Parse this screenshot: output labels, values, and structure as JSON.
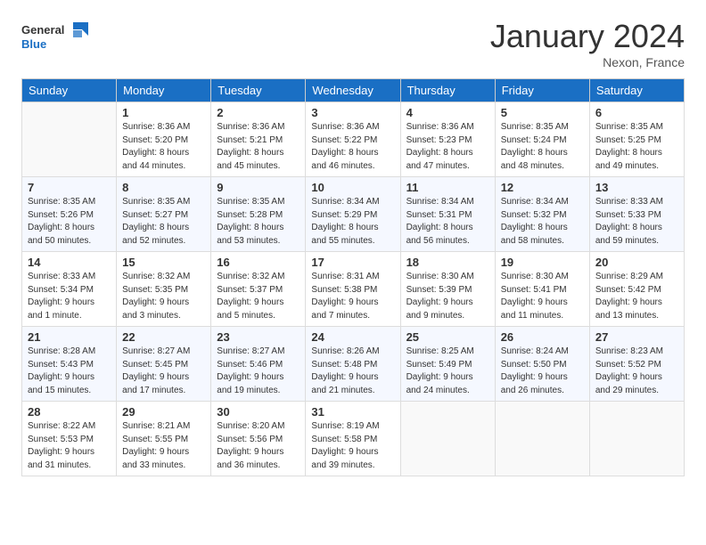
{
  "header": {
    "logo_general": "General",
    "logo_blue": "Blue",
    "title": "January 2024",
    "location": "Nexon, France"
  },
  "days_of_week": [
    "Sunday",
    "Monday",
    "Tuesday",
    "Wednesday",
    "Thursday",
    "Friday",
    "Saturday"
  ],
  "weeks": [
    [
      {
        "day": "",
        "sunrise": "",
        "sunset": "",
        "daylight": ""
      },
      {
        "day": "1",
        "sunrise": "Sunrise: 8:36 AM",
        "sunset": "Sunset: 5:20 PM",
        "daylight": "Daylight: 8 hours and 44 minutes."
      },
      {
        "day": "2",
        "sunrise": "Sunrise: 8:36 AM",
        "sunset": "Sunset: 5:21 PM",
        "daylight": "Daylight: 8 hours and 45 minutes."
      },
      {
        "day": "3",
        "sunrise": "Sunrise: 8:36 AM",
        "sunset": "Sunset: 5:22 PM",
        "daylight": "Daylight: 8 hours and 46 minutes."
      },
      {
        "day": "4",
        "sunrise": "Sunrise: 8:36 AM",
        "sunset": "Sunset: 5:23 PM",
        "daylight": "Daylight: 8 hours and 47 minutes."
      },
      {
        "day": "5",
        "sunrise": "Sunrise: 8:35 AM",
        "sunset": "Sunset: 5:24 PM",
        "daylight": "Daylight: 8 hours and 48 minutes."
      },
      {
        "day": "6",
        "sunrise": "Sunrise: 8:35 AM",
        "sunset": "Sunset: 5:25 PM",
        "daylight": "Daylight: 8 hours and 49 minutes."
      }
    ],
    [
      {
        "day": "7",
        "sunrise": "Sunrise: 8:35 AM",
        "sunset": "Sunset: 5:26 PM",
        "daylight": "Daylight: 8 hours and 50 minutes."
      },
      {
        "day": "8",
        "sunrise": "Sunrise: 8:35 AM",
        "sunset": "Sunset: 5:27 PM",
        "daylight": "Daylight: 8 hours and 52 minutes."
      },
      {
        "day": "9",
        "sunrise": "Sunrise: 8:35 AM",
        "sunset": "Sunset: 5:28 PM",
        "daylight": "Daylight: 8 hours and 53 minutes."
      },
      {
        "day": "10",
        "sunrise": "Sunrise: 8:34 AM",
        "sunset": "Sunset: 5:29 PM",
        "daylight": "Daylight: 8 hours and 55 minutes."
      },
      {
        "day": "11",
        "sunrise": "Sunrise: 8:34 AM",
        "sunset": "Sunset: 5:31 PM",
        "daylight": "Daylight: 8 hours and 56 minutes."
      },
      {
        "day": "12",
        "sunrise": "Sunrise: 8:34 AM",
        "sunset": "Sunset: 5:32 PM",
        "daylight": "Daylight: 8 hours and 58 minutes."
      },
      {
        "day": "13",
        "sunrise": "Sunrise: 8:33 AM",
        "sunset": "Sunset: 5:33 PM",
        "daylight": "Daylight: 8 hours and 59 minutes."
      }
    ],
    [
      {
        "day": "14",
        "sunrise": "Sunrise: 8:33 AM",
        "sunset": "Sunset: 5:34 PM",
        "daylight": "Daylight: 9 hours and 1 minute."
      },
      {
        "day": "15",
        "sunrise": "Sunrise: 8:32 AM",
        "sunset": "Sunset: 5:35 PM",
        "daylight": "Daylight: 9 hours and 3 minutes."
      },
      {
        "day": "16",
        "sunrise": "Sunrise: 8:32 AM",
        "sunset": "Sunset: 5:37 PM",
        "daylight": "Daylight: 9 hours and 5 minutes."
      },
      {
        "day": "17",
        "sunrise": "Sunrise: 8:31 AM",
        "sunset": "Sunset: 5:38 PM",
        "daylight": "Daylight: 9 hours and 7 minutes."
      },
      {
        "day": "18",
        "sunrise": "Sunrise: 8:30 AM",
        "sunset": "Sunset: 5:39 PM",
        "daylight": "Daylight: 9 hours and 9 minutes."
      },
      {
        "day": "19",
        "sunrise": "Sunrise: 8:30 AM",
        "sunset": "Sunset: 5:41 PM",
        "daylight": "Daylight: 9 hours and 11 minutes."
      },
      {
        "day": "20",
        "sunrise": "Sunrise: 8:29 AM",
        "sunset": "Sunset: 5:42 PM",
        "daylight": "Daylight: 9 hours and 13 minutes."
      }
    ],
    [
      {
        "day": "21",
        "sunrise": "Sunrise: 8:28 AM",
        "sunset": "Sunset: 5:43 PM",
        "daylight": "Daylight: 9 hours and 15 minutes."
      },
      {
        "day": "22",
        "sunrise": "Sunrise: 8:27 AM",
        "sunset": "Sunset: 5:45 PM",
        "daylight": "Daylight: 9 hours and 17 minutes."
      },
      {
        "day": "23",
        "sunrise": "Sunrise: 8:27 AM",
        "sunset": "Sunset: 5:46 PM",
        "daylight": "Daylight: 9 hours and 19 minutes."
      },
      {
        "day": "24",
        "sunrise": "Sunrise: 8:26 AM",
        "sunset": "Sunset: 5:48 PM",
        "daylight": "Daylight: 9 hours and 21 minutes."
      },
      {
        "day": "25",
        "sunrise": "Sunrise: 8:25 AM",
        "sunset": "Sunset: 5:49 PM",
        "daylight": "Daylight: 9 hours and 24 minutes."
      },
      {
        "day": "26",
        "sunrise": "Sunrise: 8:24 AM",
        "sunset": "Sunset: 5:50 PM",
        "daylight": "Daylight: 9 hours and 26 minutes."
      },
      {
        "day": "27",
        "sunrise": "Sunrise: 8:23 AM",
        "sunset": "Sunset: 5:52 PM",
        "daylight": "Daylight: 9 hours and 29 minutes."
      }
    ],
    [
      {
        "day": "28",
        "sunrise": "Sunrise: 8:22 AM",
        "sunset": "Sunset: 5:53 PM",
        "daylight": "Daylight: 9 hours and 31 minutes."
      },
      {
        "day": "29",
        "sunrise": "Sunrise: 8:21 AM",
        "sunset": "Sunset: 5:55 PM",
        "daylight": "Daylight: 9 hours and 33 minutes."
      },
      {
        "day": "30",
        "sunrise": "Sunrise: 8:20 AM",
        "sunset": "Sunset: 5:56 PM",
        "daylight": "Daylight: 9 hours and 36 minutes."
      },
      {
        "day": "31",
        "sunrise": "Sunrise: 8:19 AM",
        "sunset": "Sunset: 5:58 PM",
        "daylight": "Daylight: 9 hours and 39 minutes."
      },
      {
        "day": "",
        "sunrise": "",
        "sunset": "",
        "daylight": ""
      },
      {
        "day": "",
        "sunrise": "",
        "sunset": "",
        "daylight": ""
      },
      {
        "day": "",
        "sunrise": "",
        "sunset": "",
        "daylight": ""
      }
    ]
  ]
}
